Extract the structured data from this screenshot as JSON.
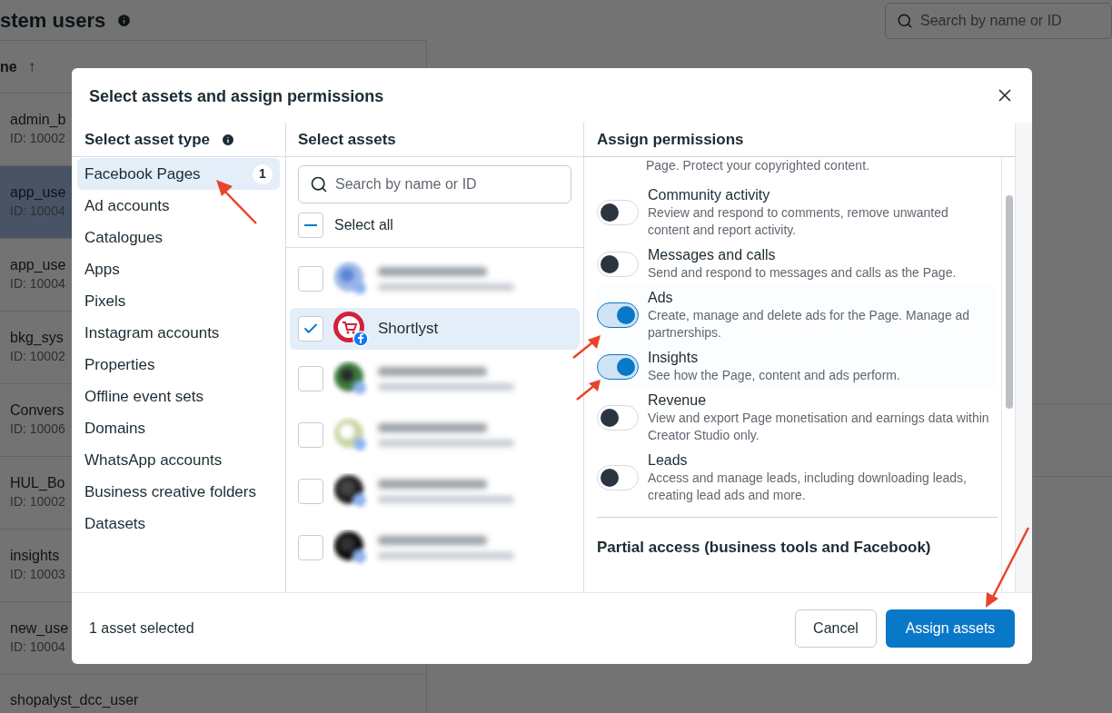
{
  "page": {
    "title": "stem users",
    "search_placeholder": "Search by name or ID",
    "column_header": "ne",
    "sort_icon": "↑",
    "users": [
      {
        "name": "admin_b",
        "id": "ID: 10002",
        "selected": false
      },
      {
        "name": "app_use",
        "id": "ID: 10004",
        "selected": true
      },
      {
        "name": "app_use",
        "id": "ID: 10004",
        "selected": false
      },
      {
        "name": "bkg_sys",
        "id": "ID: 10002",
        "selected": false
      },
      {
        "name": "Convers",
        "id": "ID: 10006",
        "selected": false
      },
      {
        "name": "HUL_Bo",
        "id": "ID: 10002",
        "selected": false
      },
      {
        "name": "insights",
        "id": "ID: 10003",
        "selected": false
      },
      {
        "name": "new_use",
        "id": "ID: 10004",
        "selected": false
      },
      {
        "name": "shopalyst_dcc_user",
        "selected": false
      }
    ]
  },
  "dialog": {
    "title": "Select assets and assign permissions",
    "asset_types": {
      "heading": "Select asset type",
      "items": [
        {
          "label": "Facebook Pages",
          "count": "1",
          "selected": true
        },
        {
          "label": "Ad accounts",
          "selected": false
        },
        {
          "label": "Catalogues",
          "selected": false
        },
        {
          "label": "Apps",
          "selected": false
        },
        {
          "label": "Pixels",
          "selected": false
        },
        {
          "label": "Instagram accounts",
          "selected": false
        },
        {
          "label": "Properties",
          "selected": false
        },
        {
          "label": "Offline event sets",
          "selected": false
        },
        {
          "label": "Domains",
          "selected": false
        },
        {
          "label": "WhatsApp accounts",
          "selected": false
        },
        {
          "label": "Business creative folders",
          "selected": false
        },
        {
          "label": "Datasets",
          "selected": false
        }
      ]
    },
    "assets": {
      "heading": "Select assets",
      "search_placeholder": "Search by name or ID",
      "select_all": {
        "label": "Select all",
        "indeterminate": true
      },
      "items": [
        {
          "kind": "blurred",
          "checked": false,
          "selected": false
        },
        {
          "kind": "page",
          "name": "Shortlyst",
          "checked": true,
          "selected": true
        },
        {
          "kind": "blurred",
          "checked": false,
          "selected": false
        },
        {
          "kind": "blurred",
          "checked": false,
          "selected": false
        },
        {
          "kind": "blurred",
          "checked": false,
          "selected": false
        },
        {
          "kind": "blurred",
          "checked": false,
          "selected": false
        }
      ]
    },
    "permissions": {
      "heading": "Assign permissions",
      "items": [
        {
          "kind": "cut",
          "description": "Page. Protect your copyrighted content."
        },
        {
          "kind": "toggle",
          "title": "Community activity",
          "description": "Review and respond to comments, remove unwanted content and report activity.",
          "on": false
        },
        {
          "kind": "toggle",
          "title": "Messages and calls",
          "description": "Send and respond to messages and calls as the Page.",
          "on": false
        },
        {
          "kind": "toggle",
          "title": "Ads",
          "description": "Create, manage and delete ads for the Page. Manage ad partnerships.",
          "on": true
        },
        {
          "kind": "toggle",
          "title": "Insights",
          "description": "See how the Page, content and ads perform.",
          "on": true
        },
        {
          "kind": "toggle",
          "title": "Revenue",
          "description": "View and export Page monetisation and earnings data within Creator Studio only.",
          "on": false
        },
        {
          "kind": "toggle",
          "title": "Leads",
          "description": "Access and manage leads, including downloading leads, creating lead ads and more.",
          "on": false
        }
      ],
      "section": "Partial access (business tools and Facebook)"
    },
    "footer": {
      "status": "1 asset selected",
      "buttons": [
        {
          "label": "Cancel",
          "kind": "secondary"
        },
        {
          "label": "Assign assets",
          "kind": "primary"
        }
      ]
    }
  }
}
